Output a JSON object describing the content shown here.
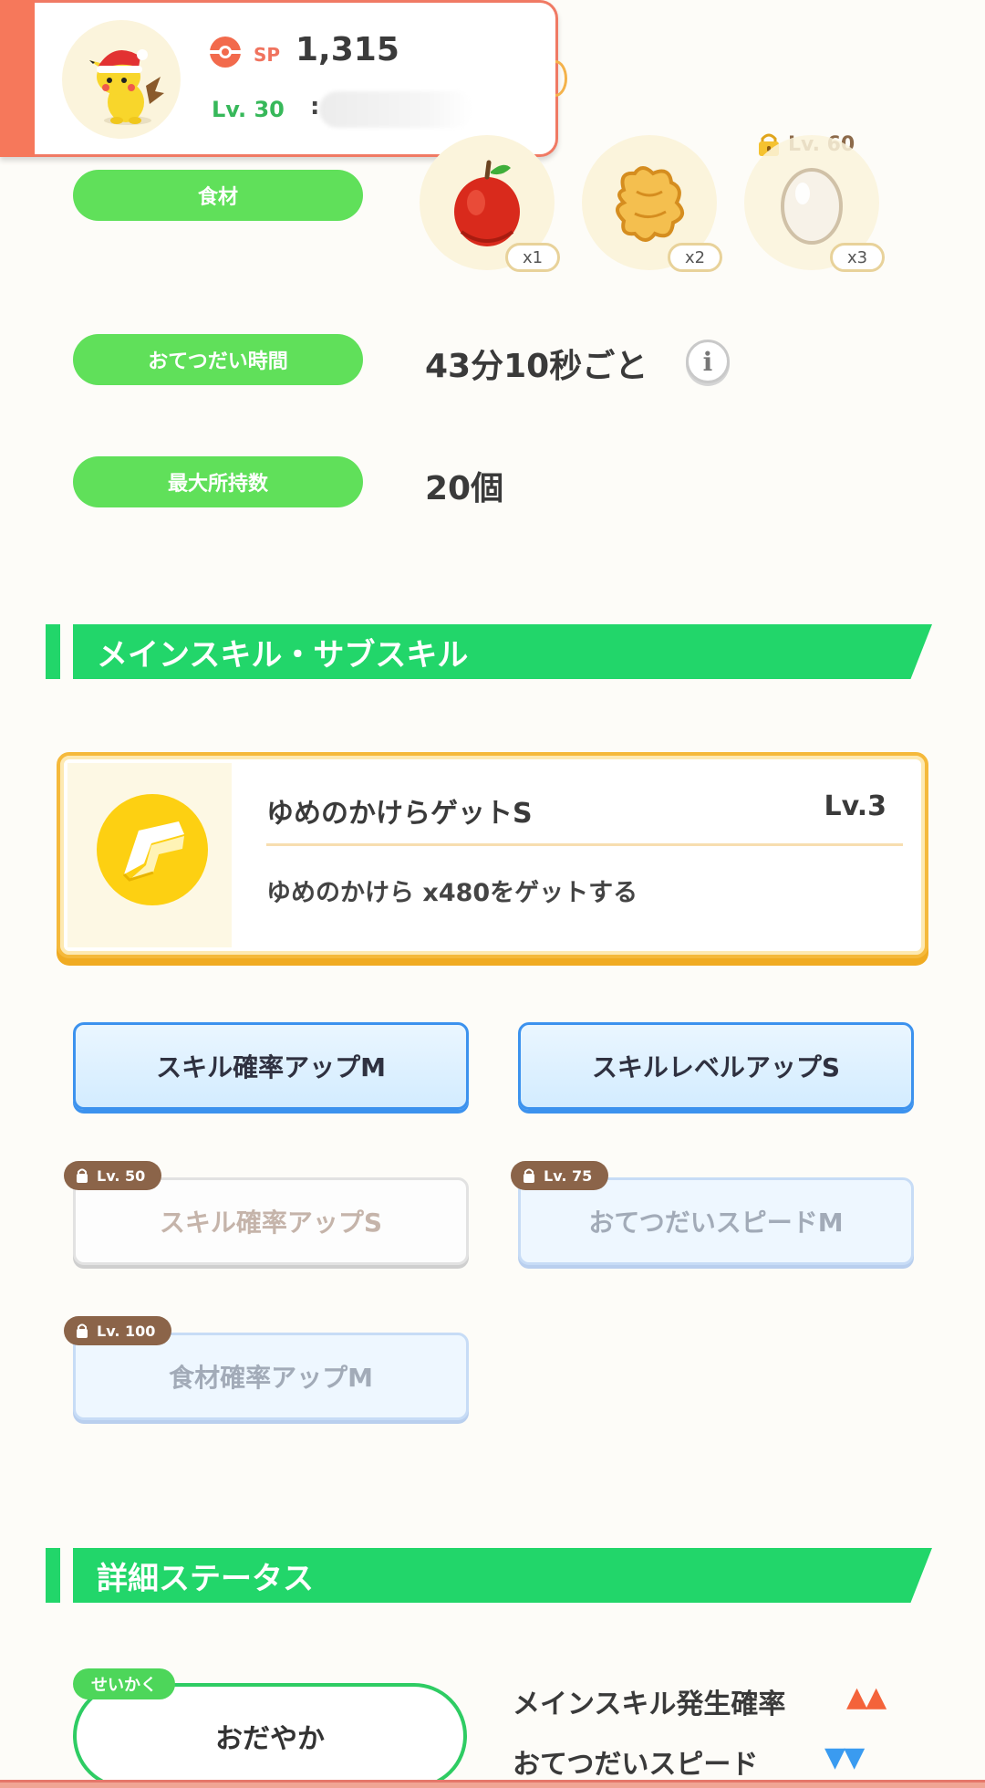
{
  "header": {
    "sp_label": "SP",
    "sp_value": "1,315",
    "level": "Lv. 30",
    "name_mark": ":"
  },
  "ingredients": {
    "label": "食材",
    "items": [
      {
        "name": "apple-icon",
        "count": "x1"
      },
      {
        "name": "ginger-icon",
        "count": "x2"
      },
      {
        "name": "egg-icon",
        "count": "x3",
        "lock_level": "Lv. 60"
      }
    ]
  },
  "help_time": {
    "label": "おてつだい時間",
    "value": "43分10秒ごと",
    "info_glyph": "i"
  },
  "max_carry": {
    "label": "最大所持数",
    "value": "20個"
  },
  "skills_section": {
    "title": "メインスキル・サブスキル",
    "main_skill": {
      "name": "ゆめのかけらゲットS",
      "level": "Lv.3",
      "description": "ゆめのかけら x480をゲットする",
      "icon": "dream-shard-icon"
    },
    "sub_skills": [
      {
        "label": "スキル確率アップM",
        "locked": false
      },
      {
        "label": "スキルレベルアップS",
        "locked": false
      },
      {
        "label": "スキル確率アップS",
        "locked": true,
        "lock_level": "Lv. 50"
      },
      {
        "label": "おてつだいスピードM",
        "locked": true,
        "lock_level": "Lv. 75"
      },
      {
        "label": "食材確率アップM",
        "locked": true,
        "lock_level": "Lv. 100"
      }
    ]
  },
  "details_section": {
    "title": "詳細ステータス",
    "nature_tag": "せいかく",
    "nature": "おだやか",
    "stats": [
      {
        "label": "メインスキル発生確率",
        "arrows": "▲▲",
        "color": "#f4633a"
      },
      {
        "label": "おてつだいスピード",
        "arrows": "▼▼",
        "color": "#3a9bf0"
      }
    ]
  },
  "colors": {
    "green": "#22d66a",
    "pill_green": "#60e05a",
    "header_accent": "#f6785b",
    "skill_gold": "#f5b93b",
    "sub_blue": "#3c92ee"
  }
}
